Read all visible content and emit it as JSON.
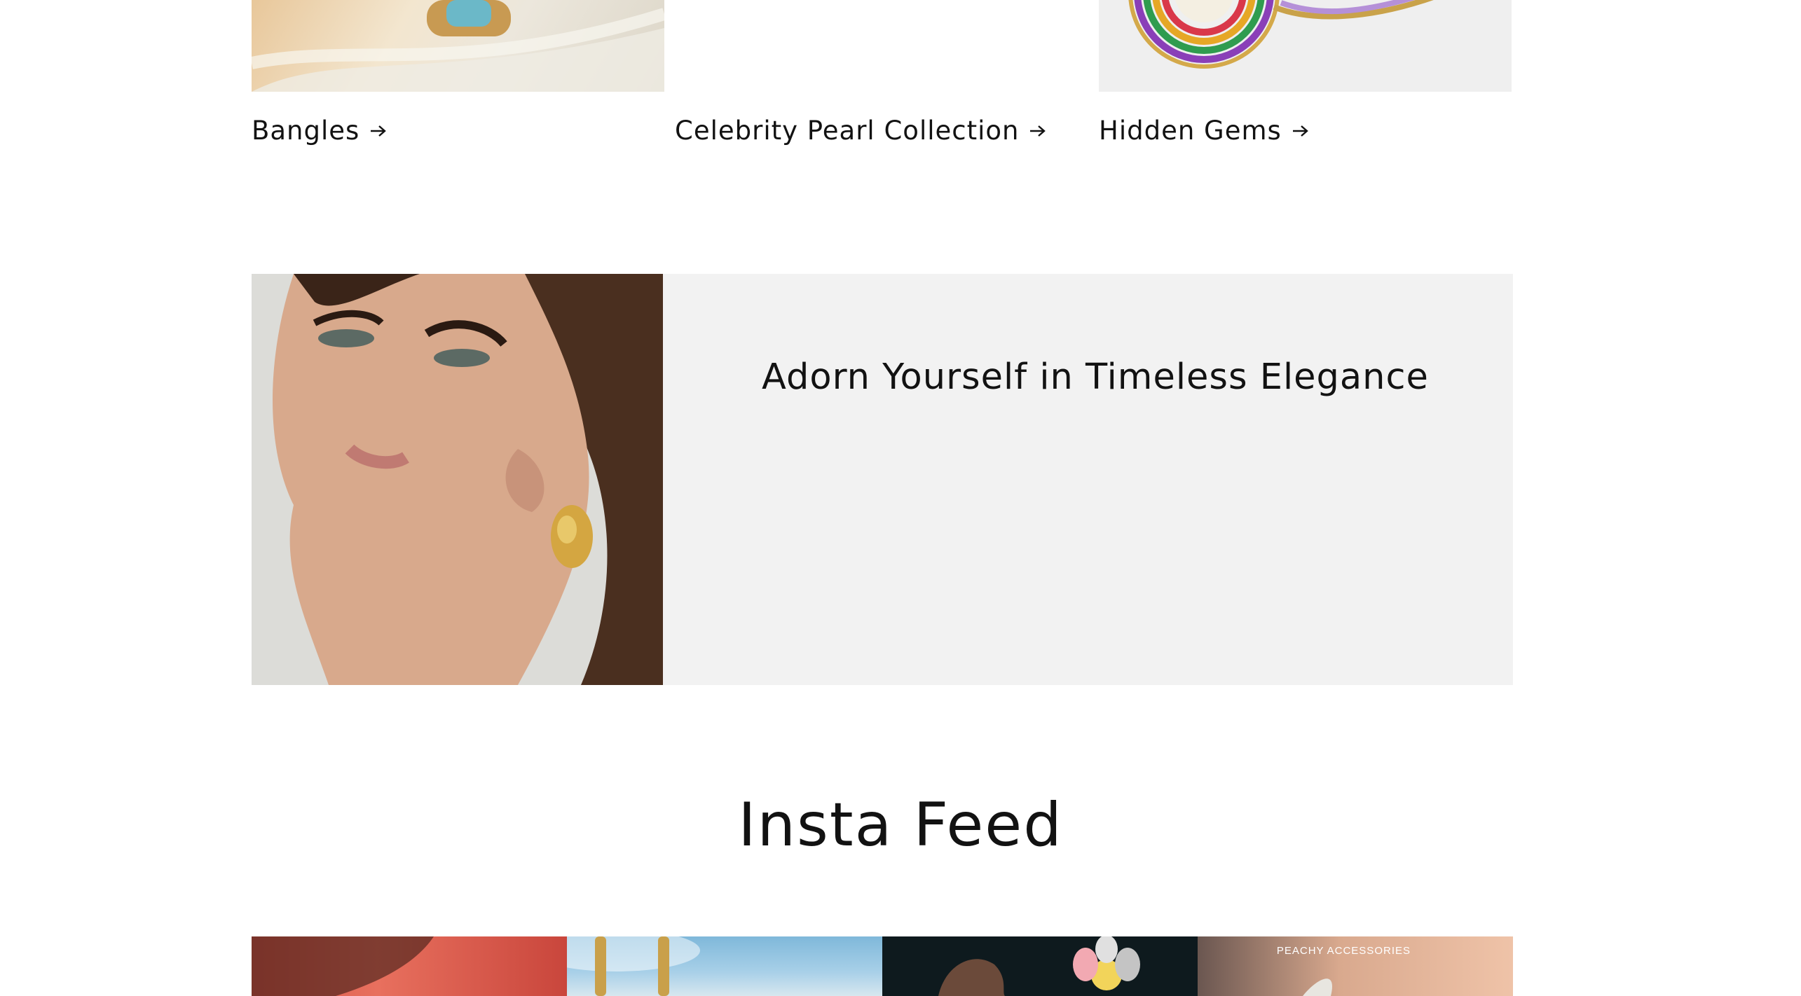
{
  "collections": [
    {
      "title": "Bangles"
    },
    {
      "title": "Celebrity Pearl Collection"
    },
    {
      "title": "Hidden Gems"
    }
  ],
  "banner": {
    "heading": "Adorn Yourself in Timeless Elegance"
  },
  "insta": {
    "title": "Insta Feed",
    "tile_4_label": "PEACHY ACCESSORIES"
  },
  "icons": {
    "collection_link": "arrow-right-icon"
  }
}
